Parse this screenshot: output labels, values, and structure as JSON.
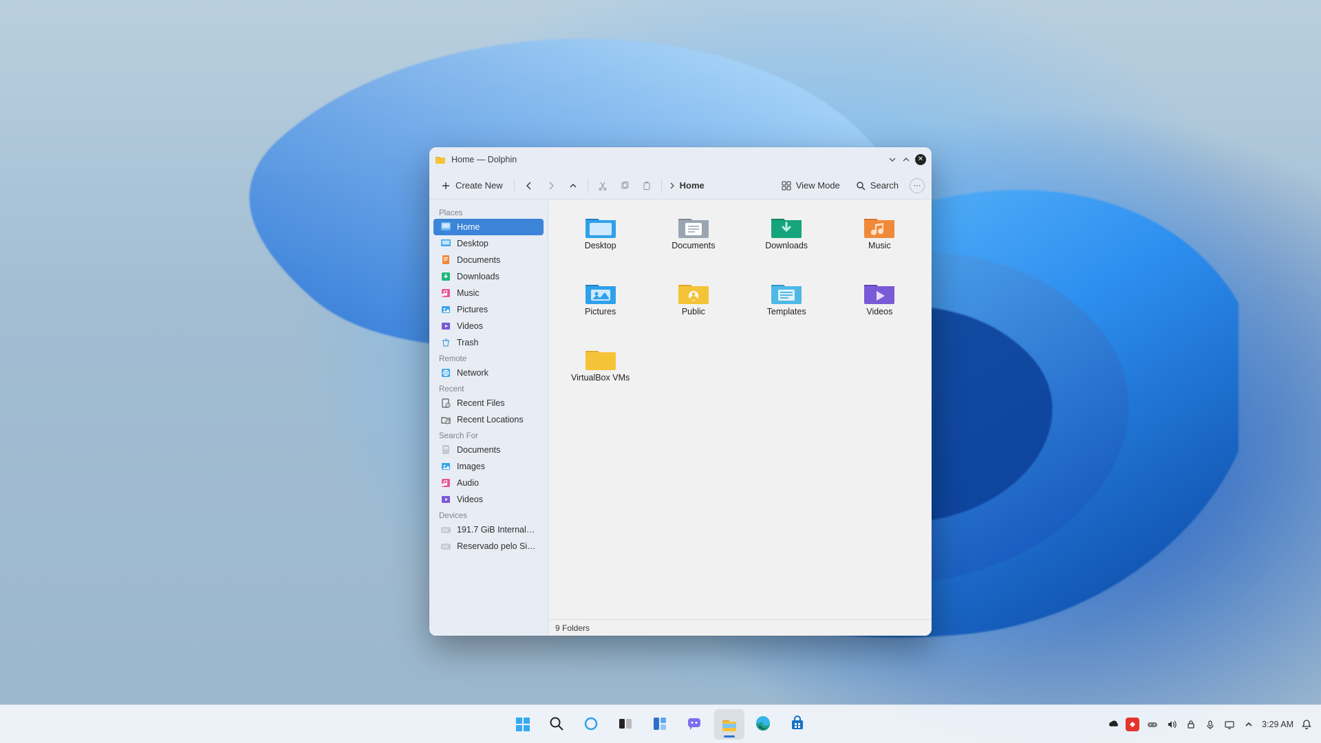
{
  "window": {
    "title": "Home — Dolphin",
    "toolbar": {
      "create_new": "Create New",
      "view_mode": "View Mode",
      "search": "Search"
    },
    "breadcrumb": {
      "current": "Home"
    },
    "statusbar": "9 Folders"
  },
  "sidebar": {
    "places_heading": "Places",
    "places": [
      {
        "label": "Home",
        "icon": "home",
        "active": true
      },
      {
        "label": "Desktop",
        "icon": "desktop"
      },
      {
        "label": "Documents",
        "icon": "documents"
      },
      {
        "label": "Downloads",
        "icon": "downloads"
      },
      {
        "label": "Music",
        "icon": "music"
      },
      {
        "label": "Pictures",
        "icon": "pictures"
      },
      {
        "label": "Videos",
        "icon": "videos"
      },
      {
        "label": "Trash",
        "icon": "trash"
      }
    ],
    "remote_heading": "Remote",
    "remote": [
      {
        "label": "Network",
        "icon": "network"
      }
    ],
    "recent_heading": "Recent",
    "recent": [
      {
        "label": "Recent Files",
        "icon": "recent-files"
      },
      {
        "label": "Recent Locations",
        "icon": "recent-locations"
      }
    ],
    "search_heading": "Search For",
    "search": [
      {
        "label": "Documents",
        "icon": "documents-gray"
      },
      {
        "label": "Images",
        "icon": "pictures"
      },
      {
        "label": "Audio",
        "icon": "music"
      },
      {
        "label": "Videos",
        "icon": "videos"
      }
    ],
    "devices_heading": "Devices",
    "devices": [
      {
        "label": "191.7 GiB Internal …",
        "icon": "drive"
      },
      {
        "label": "Reservado pelo Si…",
        "icon": "drive"
      }
    ]
  },
  "folders": [
    {
      "label": "Desktop",
      "variant": "desktop"
    },
    {
      "label": "Documents",
      "variant": "documents"
    },
    {
      "label": "Downloads",
      "variant": "downloads"
    },
    {
      "label": "Music",
      "variant": "music"
    },
    {
      "label": "Pictures",
      "variant": "pictures"
    },
    {
      "label": "Public",
      "variant": "public"
    },
    {
      "label": "Templates",
      "variant": "templates"
    },
    {
      "label": "Videos",
      "variant": "videos"
    },
    {
      "label": "VirtualBox VMs",
      "variant": "plain"
    }
  ],
  "taskbar": {
    "apps": [
      {
        "name": "start",
        "running": false
      },
      {
        "name": "search",
        "running": false
      },
      {
        "name": "cortana",
        "running": false
      },
      {
        "name": "taskview",
        "running": false
      },
      {
        "name": "widgets",
        "running": false
      },
      {
        "name": "chat",
        "running": false
      },
      {
        "name": "explorer",
        "running": true,
        "active": true
      },
      {
        "name": "edge",
        "running": false
      },
      {
        "name": "store",
        "running": false
      }
    ],
    "clock": "3:29 AM"
  },
  "colors": {
    "accent": "#3b84d8",
    "folder_yellow": "#f5c338",
    "folder_blue": "#2f9fe8",
    "folder_green": "#1fb77c",
    "folder_purple": "#7a5ad6",
    "folder_orange": "#f08a3a"
  }
}
